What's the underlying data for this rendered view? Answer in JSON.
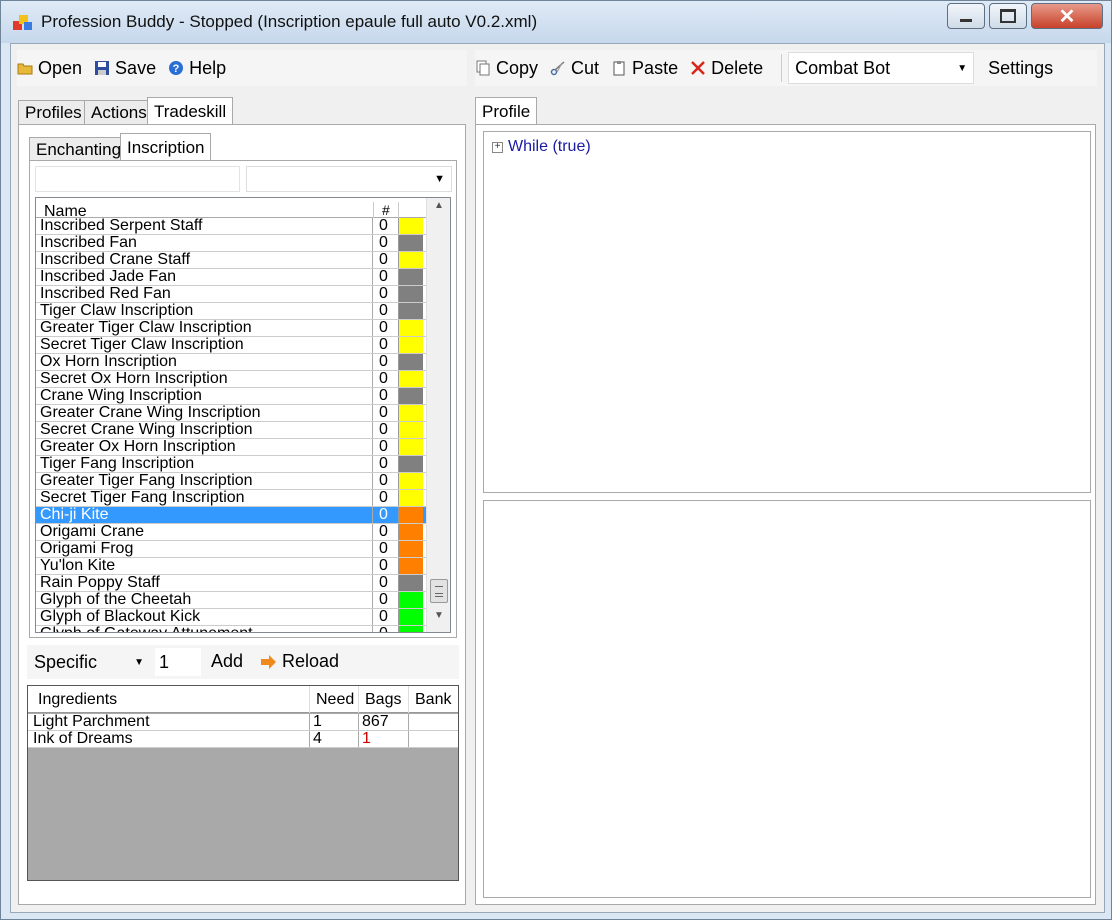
{
  "window": {
    "title": "Profession Buddy - Stopped (Inscription epaule full auto V0.2.xml)"
  },
  "toolbar_left": {
    "open_label": "Open",
    "save_label": "Save",
    "help_label": "Help"
  },
  "toolbar_right": {
    "copy_label": "Copy",
    "cut_label": "Cut",
    "paste_label": "Paste",
    "delete_label": "Delete",
    "bot_select": "Combat Bot",
    "settings_label": "Settings"
  },
  "main_tabs": {
    "profiles": "Profiles",
    "actions": "Actions",
    "tradeskill": "Tradeskill"
  },
  "skill_tabs": {
    "enchanting": "Enchanting",
    "inscription": "Inscription"
  },
  "recipe_list": {
    "col_name": "Name",
    "col_count": "#",
    "rows": [
      {
        "name": "Inscribed Serpent Staff",
        "count": "0",
        "color": "#ffff00"
      },
      {
        "name": "Inscribed Fan",
        "count": "0",
        "color": "#808080"
      },
      {
        "name": "Inscribed Crane Staff",
        "count": "0",
        "color": "#ffff00"
      },
      {
        "name": "Inscribed Jade Fan",
        "count": "0",
        "color": "#808080"
      },
      {
        "name": "Inscribed Red Fan",
        "count": "0",
        "color": "#808080"
      },
      {
        "name": "Tiger Claw Inscription",
        "count": "0",
        "color": "#808080"
      },
      {
        "name": "Greater Tiger Claw Inscription",
        "count": "0",
        "color": "#ffff00"
      },
      {
        "name": "Secret Tiger Claw Inscription",
        "count": "0",
        "color": "#ffff00"
      },
      {
        "name": "Ox Horn Inscription",
        "count": "0",
        "color": "#808080"
      },
      {
        "name": "Secret Ox Horn Inscription",
        "count": "0",
        "color": "#ffff00"
      },
      {
        "name": "Crane Wing Inscription",
        "count": "0",
        "color": "#808080"
      },
      {
        "name": "Greater Crane Wing Inscription",
        "count": "0",
        "color": "#ffff00"
      },
      {
        "name": "Secret Crane Wing Inscription",
        "count": "0",
        "color": "#ffff00"
      },
      {
        "name": "Greater Ox Horn Inscription",
        "count": "0",
        "color": "#ffff00"
      },
      {
        "name": "Tiger Fang Inscription",
        "count": "0",
        "color": "#808080"
      },
      {
        "name": "Greater Tiger Fang Inscription",
        "count": "0",
        "color": "#ffff00"
      },
      {
        "name": "Secret Tiger Fang Inscription",
        "count": "0",
        "color": "#ffff00"
      },
      {
        "name": "Chi-ji Kite",
        "count": "0",
        "color": "#ff8000",
        "selected": true
      },
      {
        "name": "Origami Crane",
        "count": "0",
        "color": "#ff8000"
      },
      {
        "name": "Origami Frog",
        "count": "0",
        "color": "#ff8000"
      },
      {
        "name": "Yu'lon Kite",
        "count": "0",
        "color": "#ff8000"
      },
      {
        "name": "Rain Poppy Staff",
        "count": "0",
        "color": "#808080"
      },
      {
        "name": "Glyph of the Cheetah",
        "count": "0",
        "color": "#00ff00"
      },
      {
        "name": "Glyph of Blackout Kick",
        "count": "0",
        "color": "#00ff00"
      },
      {
        "name": "Glyph of Gateway Attunement",
        "count": "0",
        "color": "#00ff00"
      }
    ]
  },
  "craft_bar": {
    "mode": "Specific",
    "quantity": "1",
    "add_label": "Add",
    "reload_label": "Reload"
  },
  "ingredients": {
    "headers": [
      "Ingredients",
      "Need",
      "Bags",
      "Bank"
    ],
    "rows": [
      {
        "name": "Light Parchment",
        "need": "1",
        "bags": "867",
        "bank": ""
      },
      {
        "name": "Ink of Dreams",
        "need": "4",
        "bags": "1",
        "bank": ""
      }
    ]
  },
  "profile": {
    "tab_label": "Profile",
    "tree_root": "While (true)"
  },
  "colors": {
    "selection": "#3399ff",
    "tree_text": "#1a1aa6",
    "shortage": "#cc0000"
  }
}
